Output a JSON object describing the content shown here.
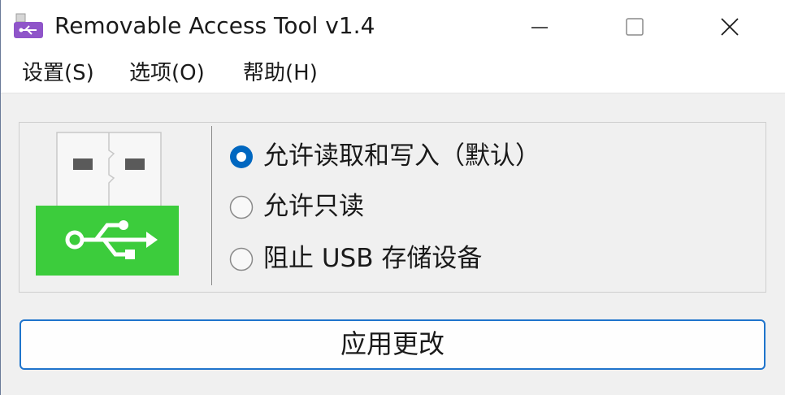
{
  "window": {
    "title": "Removable Access Tool v1.4",
    "app_icon": "usb-drive-icon"
  },
  "title_controls": {
    "minimize_icon": "minimize-icon",
    "maximize_icon": "maximize-icon",
    "close_icon": "close-icon"
  },
  "menu": {
    "items": [
      "设置(S)",
      "选项(O)",
      "帮助(H)"
    ]
  },
  "options": {
    "items": [
      {
        "label": "允许读取和写入（默认）",
        "selected": true
      },
      {
        "label": "允许只读",
        "selected": false
      },
      {
        "label": "阻止 USB 存储设备",
        "selected": false
      }
    ]
  },
  "graphic": {
    "icon": "usb-plug-icon",
    "accent_color": "#3ccc3c"
  },
  "apply_button": {
    "label": "应用更改"
  },
  "colors": {
    "radio_selected": "#0067c0",
    "button_border": "#1f74cc"
  }
}
